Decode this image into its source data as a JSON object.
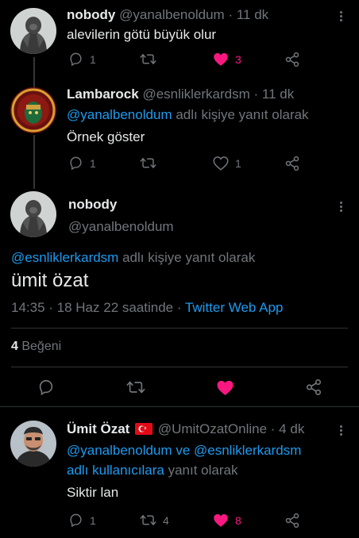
{
  "tweet1": {
    "name": "nobody",
    "handle": "@yanalbenoldum",
    "time": "· 11 dk",
    "text": "alevilerin götü büyük olur",
    "replies": "1",
    "likes": "3",
    "liked": true
  },
  "tweet2": {
    "name": "Lambarock",
    "handle": "@esnliklerkardsm",
    "time": "· 11 dk",
    "reply_mention": "@yanalbenoldum",
    "reply_suffix": "adlı kişiye yanıt olarak",
    "text": "Örnek göster",
    "replies": "1",
    "likes": "1"
  },
  "main_tweet": {
    "name": "nobody",
    "handle": "@yanalbenoldum",
    "reply_mention": "@esnliklerkardsm",
    "reply_suffix": "adlı kişiye yanıt olarak",
    "text": "ümit özat",
    "timestamp": "14:35 · 18 Haz 22 saatinde ·",
    "source": "Twitter Web App",
    "like_count": "4",
    "like_label": "Beğeni"
  },
  "tweet3": {
    "name": "Ümit Özat",
    "flag": "🇹🇷",
    "handle": "@UmitOzatOnline",
    "time": "· 4 dk",
    "mention1": "@yanalbenoldum",
    "connector": "ve",
    "mention2": "@esnliklerkardsm",
    "mention3": "adlı kullanıcılara",
    "reply_suffix": "yanıt olarak",
    "text": "Siktir lan",
    "replies": "1",
    "retweets": "4",
    "likes": "8",
    "liked": true
  },
  "colors": {
    "background": "#000000",
    "text": "#e7e9ea",
    "muted": "#71767b",
    "link": "#1d9bf0",
    "like": "#f91880"
  }
}
